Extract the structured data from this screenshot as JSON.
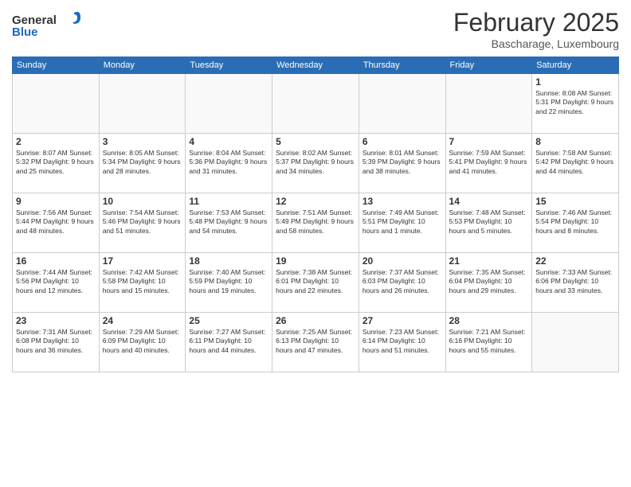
{
  "header": {
    "logo_general": "General",
    "logo_blue": "Blue",
    "month_title": "February 2025",
    "location": "Bascharage, Luxembourg"
  },
  "weekdays": [
    "Sunday",
    "Monday",
    "Tuesday",
    "Wednesday",
    "Thursday",
    "Friday",
    "Saturday"
  ],
  "weeks": [
    [
      {
        "day": "",
        "info": ""
      },
      {
        "day": "",
        "info": ""
      },
      {
        "day": "",
        "info": ""
      },
      {
        "day": "",
        "info": ""
      },
      {
        "day": "",
        "info": ""
      },
      {
        "day": "",
        "info": ""
      },
      {
        "day": "1",
        "info": "Sunrise: 8:08 AM\nSunset: 5:31 PM\nDaylight: 9 hours and 22 minutes."
      }
    ],
    [
      {
        "day": "2",
        "info": "Sunrise: 8:07 AM\nSunset: 5:32 PM\nDaylight: 9 hours and 25 minutes."
      },
      {
        "day": "3",
        "info": "Sunrise: 8:05 AM\nSunset: 5:34 PM\nDaylight: 9 hours and 28 minutes."
      },
      {
        "day": "4",
        "info": "Sunrise: 8:04 AM\nSunset: 5:36 PM\nDaylight: 9 hours and 31 minutes."
      },
      {
        "day": "5",
        "info": "Sunrise: 8:02 AM\nSunset: 5:37 PM\nDaylight: 9 hours and 34 minutes."
      },
      {
        "day": "6",
        "info": "Sunrise: 8:01 AM\nSunset: 5:39 PM\nDaylight: 9 hours and 38 minutes."
      },
      {
        "day": "7",
        "info": "Sunrise: 7:59 AM\nSunset: 5:41 PM\nDaylight: 9 hours and 41 minutes."
      },
      {
        "day": "8",
        "info": "Sunrise: 7:58 AM\nSunset: 5:42 PM\nDaylight: 9 hours and 44 minutes."
      }
    ],
    [
      {
        "day": "9",
        "info": "Sunrise: 7:56 AM\nSunset: 5:44 PM\nDaylight: 9 hours and 48 minutes."
      },
      {
        "day": "10",
        "info": "Sunrise: 7:54 AM\nSunset: 5:46 PM\nDaylight: 9 hours and 51 minutes."
      },
      {
        "day": "11",
        "info": "Sunrise: 7:53 AM\nSunset: 5:48 PM\nDaylight: 9 hours and 54 minutes."
      },
      {
        "day": "12",
        "info": "Sunrise: 7:51 AM\nSunset: 5:49 PM\nDaylight: 9 hours and 58 minutes."
      },
      {
        "day": "13",
        "info": "Sunrise: 7:49 AM\nSunset: 5:51 PM\nDaylight: 10 hours and 1 minute."
      },
      {
        "day": "14",
        "info": "Sunrise: 7:48 AM\nSunset: 5:53 PM\nDaylight: 10 hours and 5 minutes."
      },
      {
        "day": "15",
        "info": "Sunrise: 7:46 AM\nSunset: 5:54 PM\nDaylight: 10 hours and 8 minutes."
      }
    ],
    [
      {
        "day": "16",
        "info": "Sunrise: 7:44 AM\nSunset: 5:56 PM\nDaylight: 10 hours and 12 minutes."
      },
      {
        "day": "17",
        "info": "Sunrise: 7:42 AM\nSunset: 5:58 PM\nDaylight: 10 hours and 15 minutes."
      },
      {
        "day": "18",
        "info": "Sunrise: 7:40 AM\nSunset: 5:59 PM\nDaylight: 10 hours and 19 minutes."
      },
      {
        "day": "19",
        "info": "Sunrise: 7:38 AM\nSunset: 6:01 PM\nDaylight: 10 hours and 22 minutes."
      },
      {
        "day": "20",
        "info": "Sunrise: 7:37 AM\nSunset: 6:03 PM\nDaylight: 10 hours and 26 minutes."
      },
      {
        "day": "21",
        "info": "Sunrise: 7:35 AM\nSunset: 6:04 PM\nDaylight: 10 hours and 29 minutes."
      },
      {
        "day": "22",
        "info": "Sunrise: 7:33 AM\nSunset: 6:06 PM\nDaylight: 10 hours and 33 minutes."
      }
    ],
    [
      {
        "day": "23",
        "info": "Sunrise: 7:31 AM\nSunset: 6:08 PM\nDaylight: 10 hours and 36 minutes."
      },
      {
        "day": "24",
        "info": "Sunrise: 7:29 AM\nSunset: 6:09 PM\nDaylight: 10 hours and 40 minutes."
      },
      {
        "day": "25",
        "info": "Sunrise: 7:27 AM\nSunset: 6:11 PM\nDaylight: 10 hours and 44 minutes."
      },
      {
        "day": "26",
        "info": "Sunrise: 7:25 AM\nSunset: 6:13 PM\nDaylight: 10 hours and 47 minutes."
      },
      {
        "day": "27",
        "info": "Sunrise: 7:23 AM\nSunset: 6:14 PM\nDaylight: 10 hours and 51 minutes."
      },
      {
        "day": "28",
        "info": "Sunrise: 7:21 AM\nSunset: 6:16 PM\nDaylight: 10 hours and 55 minutes."
      },
      {
        "day": "",
        "info": ""
      }
    ]
  ]
}
